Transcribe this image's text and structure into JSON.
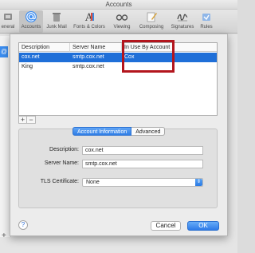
{
  "window": {
    "title": "Accounts"
  },
  "toolbar": {
    "items": [
      {
        "label": "eneral",
        "icon": "general-switch-icon"
      },
      {
        "label": "Accounts",
        "icon": "at-sign-icon",
        "selected": true
      },
      {
        "label": "Junk Mail",
        "icon": "trash-icon"
      },
      {
        "label": "Fonts & Colors",
        "icon": "fonts-colors-icon"
      },
      {
        "label": "Viewing",
        "icon": "glasses-icon"
      },
      {
        "label": "Composing",
        "icon": "pencil-icon"
      },
      {
        "label": "Signatures",
        "icon": "signature-icon"
      },
      {
        "label": "Rules",
        "icon": "rules-icon"
      }
    ]
  },
  "sidebar": {
    "account_glyph": "@",
    "add_glyph": "+"
  },
  "sheet": {
    "table": {
      "columns": [
        "Description",
        "Server Name",
        "In Use By Account"
      ],
      "rows": [
        {
          "description": "cox.net",
          "server": "smtp.cox.net",
          "in_use": "Cox",
          "selected": true
        },
        {
          "description": "King",
          "server": "smtp.cox.net",
          "in_use": ""
        }
      ]
    },
    "callout_color": "#b3151d",
    "add_button": "+",
    "remove_button": "−",
    "tabs": {
      "active": "Account Information",
      "inactive": "Advanced"
    },
    "form": {
      "description_label": "Description:",
      "description_value": "cox.net",
      "server_label": "Server Name:",
      "server_value": "smtp.cox.net",
      "tls_label": "TLS Certificate:",
      "tls_value": "None"
    },
    "buttons": {
      "help": "?",
      "cancel": "Cancel",
      "ok": "OK"
    },
    "accent_color": "#2f7ee6"
  }
}
